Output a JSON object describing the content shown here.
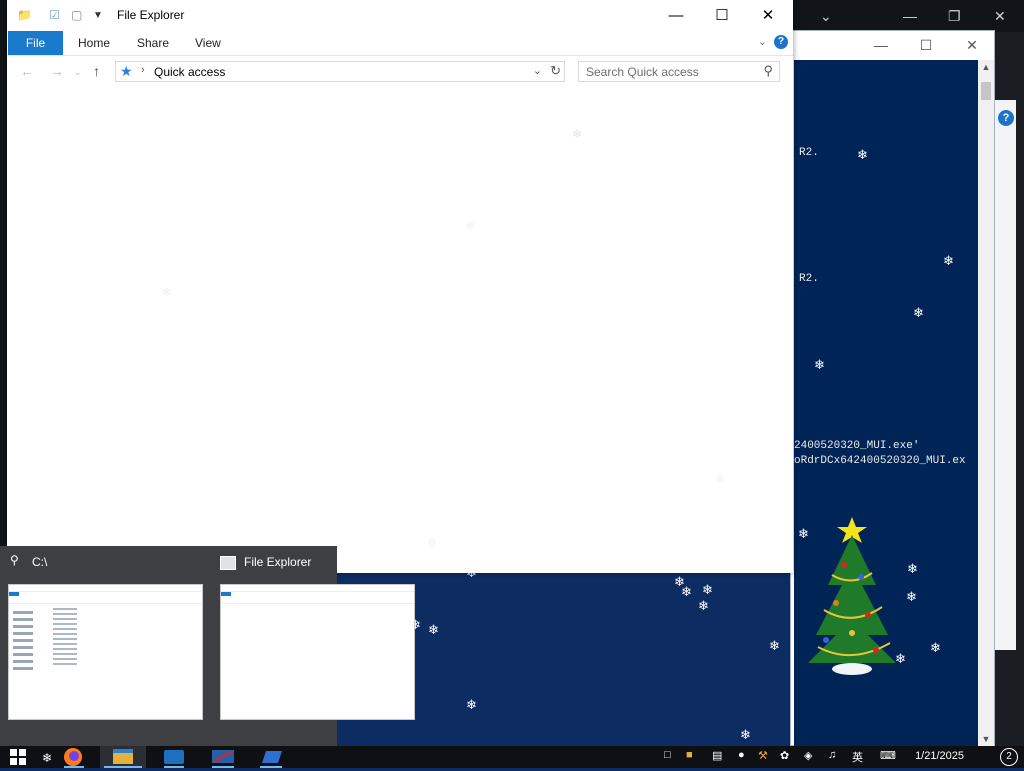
{
  "explorer": {
    "title": "File Explorer",
    "ribbon": {
      "file": "File",
      "home": "Home",
      "share": "Share",
      "view": "View"
    },
    "address": {
      "path": "Quick access"
    },
    "search": {
      "placeholder": "Search Quick access"
    }
  },
  "console": {
    "lines": [
      "R2.",
      "R2.",
      "2400520320_MUI.exe'",
      "oRdrDCx642400520320_MUI.ex"
    ]
  },
  "thumbnails": [
    {
      "label": "C:\\"
    },
    {
      "label": "File Explorer"
    }
  ],
  "taskbar": {
    "date": "1/21/2025",
    "notifications": "2",
    "ime": "英"
  },
  "colors": {
    "ribbon_blue": "#1979ca",
    "console_bg": "#012456",
    "taskbar_bg": "#0f1013",
    "thumb_bg": "#3d3f42"
  }
}
